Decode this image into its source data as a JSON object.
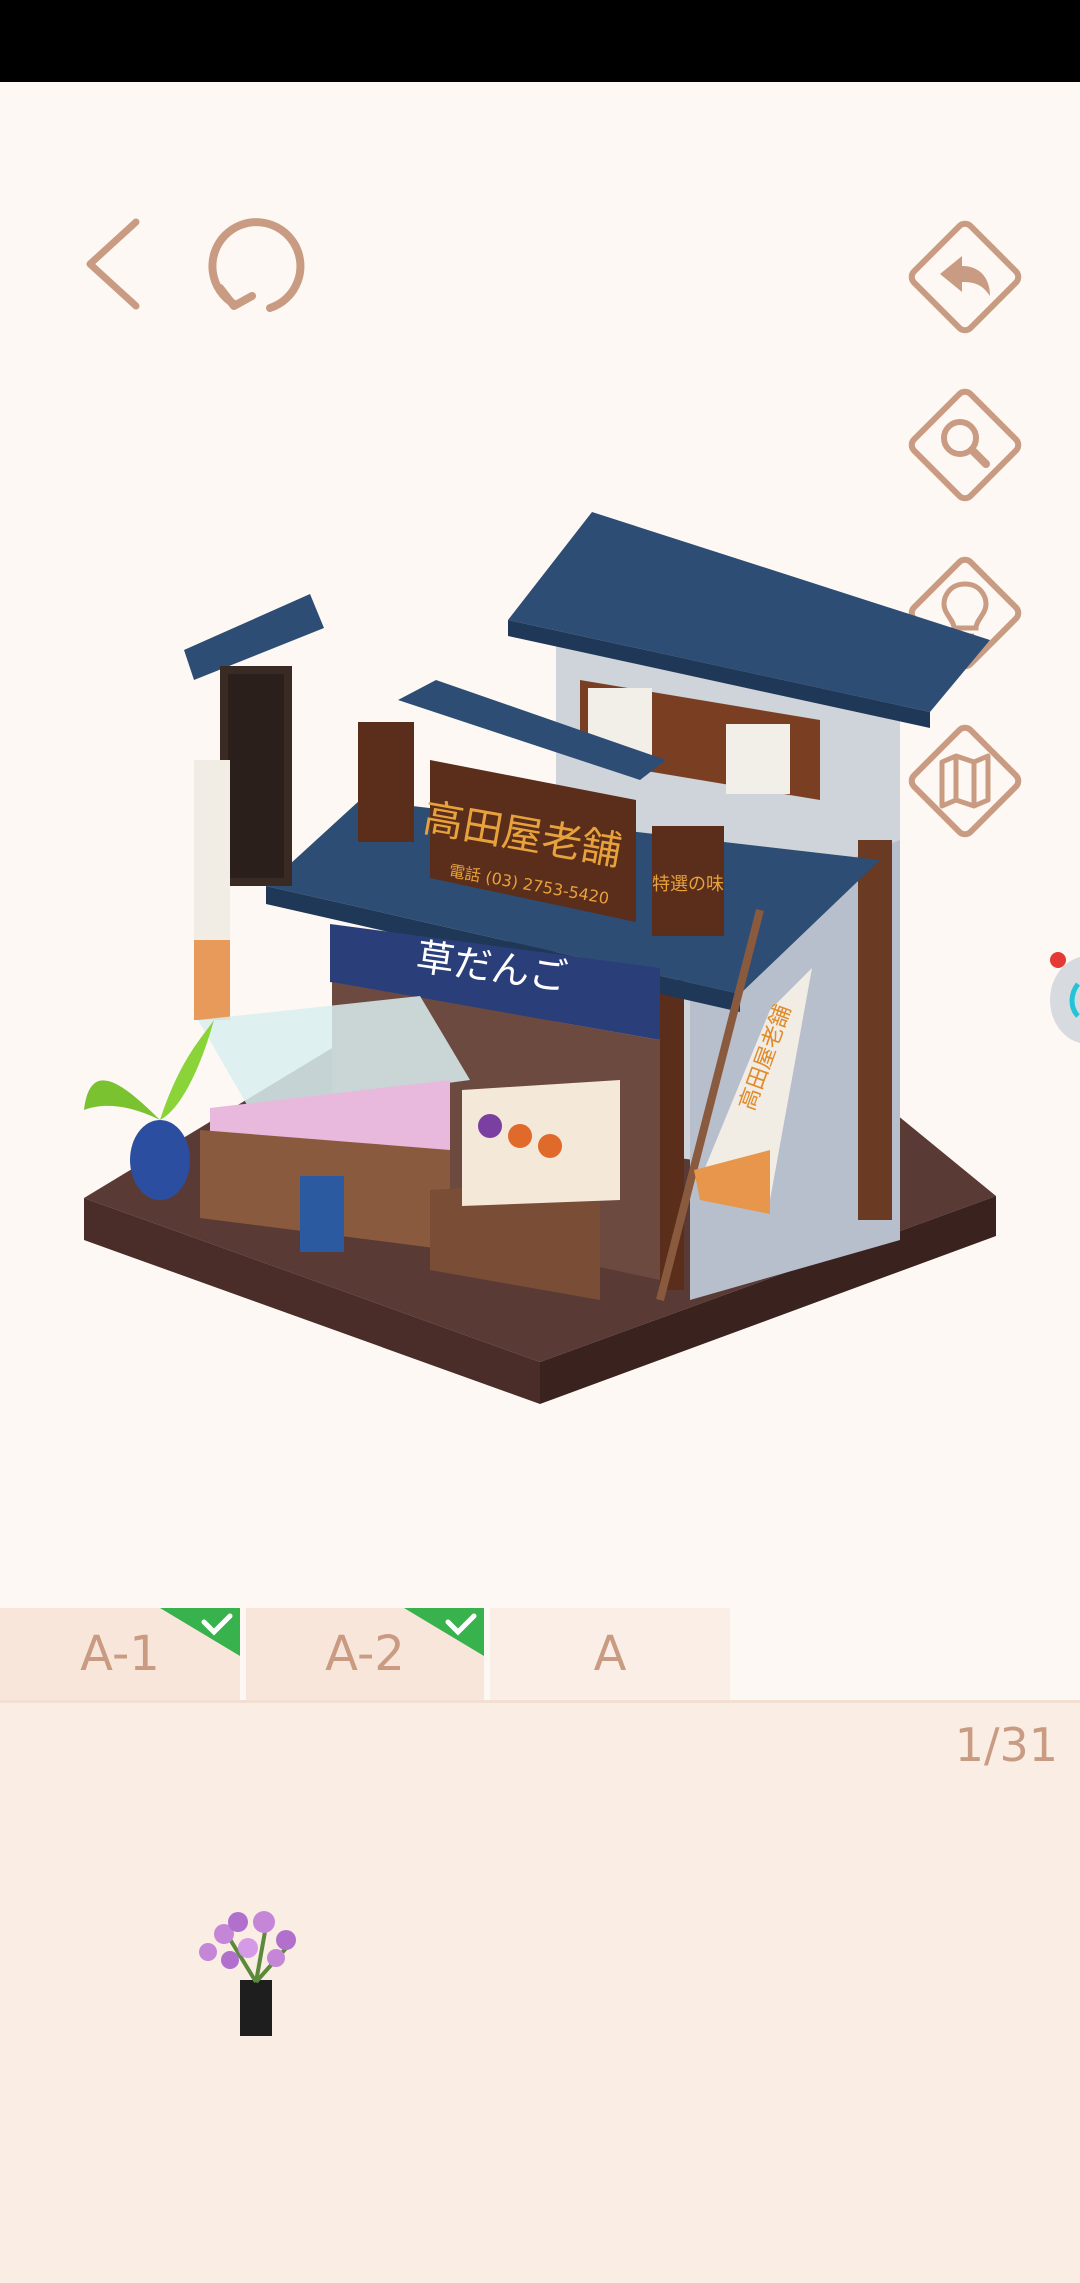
{
  "colors": {
    "icon": "#c99b82",
    "background": "#fdf8f3",
    "tray": "#faeee4",
    "tab": "#f9e6db",
    "check": "#37b24d"
  },
  "toolbar": {
    "back_icon": "chevron-left-icon",
    "reset_icon": "refresh-icon",
    "undo_icon": "undo-icon",
    "zoom_icon": "magnifier-icon",
    "hint_icon": "lightbulb-icon",
    "map_icon": "map-icon"
  },
  "scene": {
    "shop_sign": "高田屋老舗",
    "shop_phone": "電話 (03) 2753-5420",
    "noren_text": "草だんご",
    "banner_text": "高田屋老舗",
    "side_sign": "特選の味"
  },
  "tabs": [
    {
      "label": "A-1",
      "completed": true
    },
    {
      "label": "A-2",
      "completed": true
    },
    {
      "label": "A",
      "completed": false
    }
  ],
  "tray": {
    "page_counter": "1/31",
    "items": [
      {
        "icon": "flower-vase-icon"
      }
    ]
  }
}
